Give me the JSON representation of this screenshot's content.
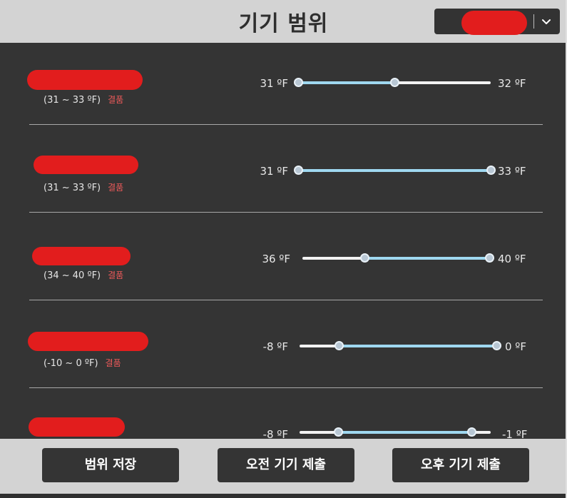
{
  "header": {
    "title": "기기 범위",
    "selector_value": ""
  },
  "colors": {
    "panel": "#343434",
    "track": "#f2f2f2",
    "fill": "#9fd8f0",
    "defect": "#ef5a5a",
    "redaction": "#e21d1d"
  },
  "devices": [
    {
      "name": "",
      "range": "(31 ~ 33 ºF)",
      "status": "결품",
      "min_label": "31 ºF",
      "max_label": "32 ºF",
      "low": 0.0,
      "high": 0.5
    },
    {
      "name": "",
      "range": "(31 ~ 33 ºF)",
      "status": "결품",
      "min_label": "31 ºF",
      "max_label": "33 ºF",
      "low": 0.0,
      "high": 1.0
    },
    {
      "name": "",
      "range": "(34 ~ 40 ºF)",
      "status": "결품",
      "min_label": "36 ºF",
      "max_label": "40 ºF",
      "low": 0.333,
      "high": 1.0
    },
    {
      "name": "",
      "range": "(-10 ~ 0 ºF)",
      "status": "결품",
      "min_label": "-8 ºF",
      "max_label": "0 ºF",
      "low": 0.2,
      "high": 1.0
    },
    {
      "name": "",
      "range": "",
      "status": "",
      "min_label": "-8 ºF",
      "max_label": "-1 ºF",
      "low": 0.2,
      "high": 0.9
    }
  ],
  "footer": {
    "save_label": "범위 저장",
    "am_label": "오전 기기 제출",
    "pm_label": "오후 기기 제출"
  }
}
